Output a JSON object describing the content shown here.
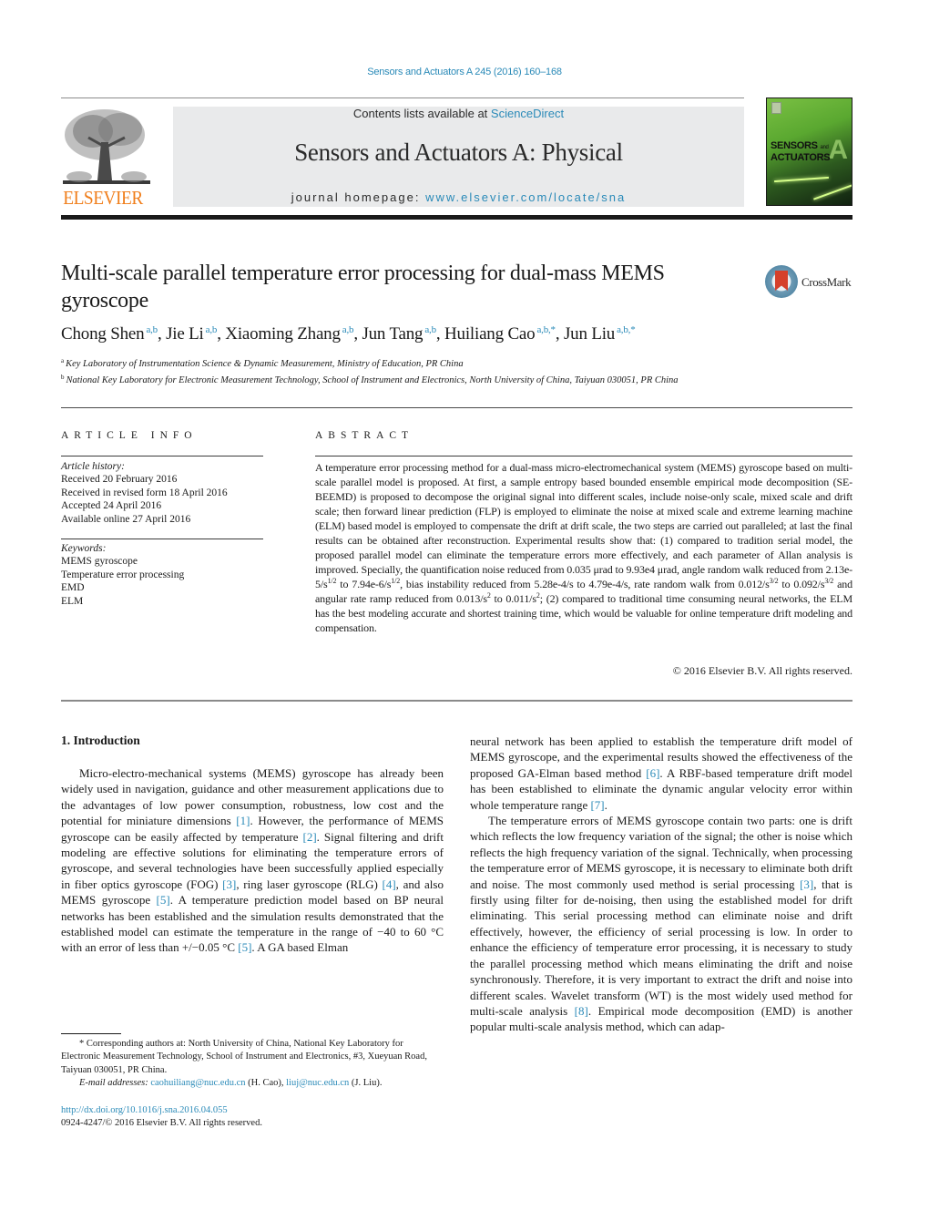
{
  "header": {
    "citation": "Sensors and Actuators A 245 (2016) 160–168",
    "contents_prefix": "Contents lists available at ",
    "contents_link": "ScienceDirect",
    "journal_title": "Sensors and Actuators A: Physical",
    "homepage_prefix": "journal homepage: ",
    "homepage_link": "www.elsevier.com/locate/sna",
    "publisher_wordmark": "ELSEVIER",
    "cover_title_line1": "SENSORS",
    "cover_title_and": "and",
    "cover_title_line2": "ACTUATORS",
    "cover_letter": "A",
    "accent_color": "#2a8ab8",
    "publisher_color": "#f07e1b"
  },
  "article": {
    "title": "Multi-scale parallel temperature error processing for dual-mass MEMS gyroscope",
    "crossmark_label": "CrossMark",
    "authors": [
      {
        "name": "Chong Shen",
        "affil": "a,b"
      },
      {
        "name": "Jie Li",
        "affil": "a,b"
      },
      {
        "name": "Xiaoming Zhang",
        "affil": "a,b"
      },
      {
        "name": "Jun Tang",
        "affil": "a,b"
      },
      {
        "name": "Huiliang Cao",
        "affil": "a,b,*"
      },
      {
        "name": "Jun Liu",
        "affil": "a,b,*"
      }
    ],
    "affiliations": [
      {
        "mark": "a",
        "text": "Key Laboratory of Instrumentation Science & Dynamic Measurement, Ministry of Education, PR China"
      },
      {
        "mark": "b",
        "text": "National Key Laboratory for Electronic Measurement Technology, School of Instrument and Electronics, North University of China, Taiyuan 030051, PR China"
      }
    ]
  },
  "article_info": {
    "heading": "ARTICLE INFO",
    "history_label": "Article history:",
    "history": [
      "Received 20 February 2016",
      "Received in revised form 18 April 2016",
      "Accepted 24 April 2016",
      "Available online 27 April 2016"
    ],
    "keywords_label": "Keywords:",
    "keywords": [
      "MEMS gyroscope",
      "Temperature error processing",
      "EMD",
      "ELM"
    ]
  },
  "abstract": {
    "heading": "ABSTRACT",
    "part1": "A temperature error processing method for a dual-mass micro-electromechanical system (MEMS) gyroscope based on multi-scale parallel model is proposed. At first, a sample entropy based bounded ensemble empirical mode decomposition (SE-BEEMD) is proposed to decompose the original signal into different scales, include noise-only scale, mixed scale and drift scale; then forward linear prediction (FLP) is employed to eliminate the noise at mixed scale and extreme learning machine (ELM) based model is employed to compensate the drift at drift scale, the two steps are carried out paralleled; at last the final results can be obtained after reconstruction. Experimental results show that: (1) compared to tradition serial model, the proposed parallel model can eliminate the temperature errors more effectively, and each parameter of Allan analysis is improved. Specially, the quantification noise reduced from 0.035 μrad to 9.93e4 μrad, angle random walk reduced from 2.13e-5/s",
    "sup1": "1/2",
    "part2": " to 7.94e-6/s",
    "sup2": "1/2",
    "part3": ", bias instability reduced from 5.28e-4/s to 4.79e-4/s, rate random walk from 0.012/s",
    "sup3": "3/2",
    "part4": " to 0.092/s",
    "sup4": "3/2",
    "part5": " and angular rate ramp reduced from 0.013/s",
    "sup5": "2",
    "part6": " to 0.011/s",
    "sup6": "2",
    "part7": "; (2) compared to traditional time consuming neural networks, the ELM has the best modeling accurate and shortest training time, which would be valuable for online temperature drift modeling and compensation.",
    "copyright": "© 2016 Elsevier B.V. All rights reserved."
  },
  "body": {
    "section_heading": "1.  Introduction",
    "left_p1": [
      {
        "t": "Micro-electro-mechanical systems (MEMS) gyroscope has already been widely used in navigation, guidance and other measurement applications due to the advantages of low power consumption, robustness, low cost and the potential for miniature dimensions "
      },
      {
        "ref": "[1]"
      },
      {
        "t": ". However, the performance of MEMS gyroscope can be easily affected by temperature "
      },
      {
        "ref": "[2]"
      },
      {
        "t": ". Signal filtering and drift modeling are effective solutions for eliminating the temperature errors of gyroscope, and several technologies have been successfully applied especially in fiber optics gyroscope (FOG) "
      },
      {
        "ref": "[3]"
      },
      {
        "t": ", ring laser gyroscope (RLG) "
      },
      {
        "ref": "[4]"
      },
      {
        "t": ", and also MEMS gyroscope "
      },
      {
        "ref": "[5]"
      },
      {
        "t": ". A temperature prediction model based on BP neural networks has been established and the simulation results demonstrated that the established model can estimate the temperature in the range of −40 to 60 °C with an error of less than +/−0.05 °C "
      },
      {
        "ref": "[5]"
      },
      {
        "t": ". A GA based Elman"
      }
    ],
    "right_p1": [
      {
        "t": "neural network has been applied to establish the temperature drift model of MEMS gyroscope, and the experimental results showed the effectiveness of the proposed GA-Elman based method "
      },
      {
        "ref": "[6]"
      },
      {
        "t": ". A RBF-based temperature drift model has been established to eliminate the dynamic angular velocity error within whole temperature range "
      },
      {
        "ref": "[7]"
      },
      {
        "t": "."
      }
    ],
    "right_p2": [
      {
        "t": "The temperature errors of MEMS gyroscope contain two parts: one is drift which reflects the low frequency variation of the signal; the other is noise which reflects the high frequency variation of the signal. Technically, when processing the temperature error of MEMS gyroscope, it is necessary to eliminate both drift and noise. The most commonly used method is serial processing "
      },
      {
        "ref": "[3]"
      },
      {
        "t": ", that is firstly using filter for de-noising, then using the established model for drift eliminating. This serial processing method can eliminate noise and drift effectively, however, the efficiency of serial processing is low. In order to enhance the efficiency of temperature error processing, it is necessary to study the parallel processing method which means eliminating the drift and noise synchronously. Therefore, it is very important to extract the drift and noise into different scales. Wavelet transform (WT) is the most widely used method for multi-scale analysis "
      },
      {
        "ref": "[8]"
      },
      {
        "t": ". Empirical mode decomposition (EMD) is another popular multi-scale analysis method, which can adap-"
      }
    ]
  },
  "footnote": {
    "star": "*",
    "corresponding": " Corresponding authors at: North University of China, National Key Laboratory for Electronic Measurement Technology, School of Instrument and Electronics, #3, Xueyuan Road, Taiyuan 030051, PR China.",
    "email_label": "E-mail addresses:",
    "email1": "caohuiliang@nuc.edu.cn",
    "email1_owner": " (H. Cao), ",
    "email2": "liuj@nuc.edu.cn",
    "email2_owner": " (J. Liu).",
    "doi": "http://dx.doi.org/10.1016/j.sna.2016.04.055",
    "issn_copyright": "0924-4247/© 2016 Elsevier B.V. All rights reserved."
  }
}
